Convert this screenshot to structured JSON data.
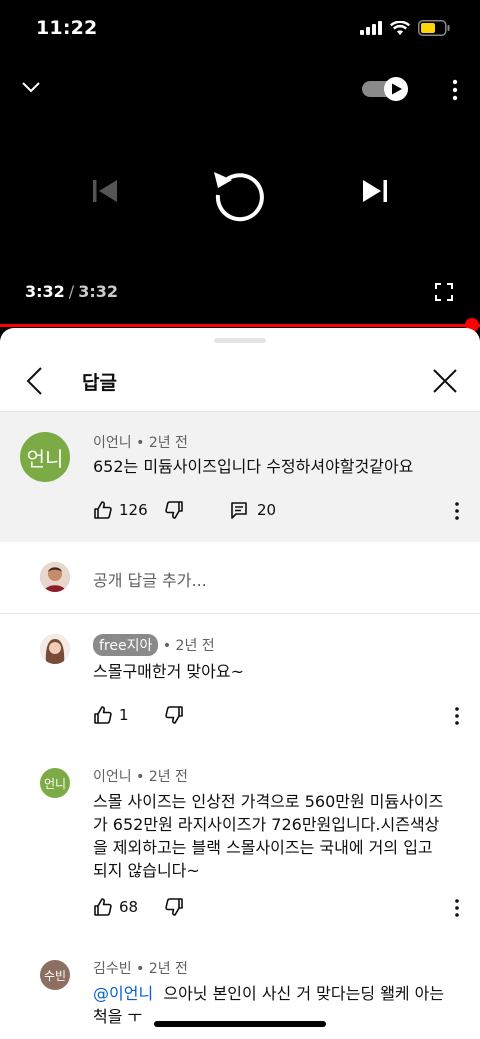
{
  "status": {
    "time": "11:22"
  },
  "player": {
    "current_time": "3:32",
    "separator": "/",
    "total_time": "3:32",
    "progress_fraction": 1.0,
    "accent_color": "#ff0000"
  },
  "sheet": {
    "title": "답글",
    "parent": {
      "avatar_text": "언니",
      "author": "이언니",
      "age": "2년 전",
      "text": "652는 미듐사이즈입니다 수정하셔야할것같아요",
      "likes": "126",
      "replies": "20"
    },
    "composer": {
      "placeholder": "공개 답글 추가..."
    },
    "replies": [
      {
        "author": "free지아",
        "age": "2년 전",
        "text": "스몰구매한거 맞아요~",
        "likes": "1"
      },
      {
        "avatar_text": "언니",
        "author": "이언니",
        "age": "2년 전",
        "text_lines": [
          "스몰 사이즈는 인상전 가격으로 560만원 미듐사이즈",
          "가 652만원 라지사이즈가 726만원입니다.시즌색상",
          "을 제외하고는 블랙 스몰사이즈는 국내에 거의 입고",
          "되지 않습니다~"
        ],
        "likes": "68"
      },
      {
        "avatar_text": "수빈",
        "author": "김수빈",
        "age": "2년 전",
        "mention": "@이언니",
        "text_line1": "으아닛 본인이 사신 거 맞다는딩 왤케 아는",
        "text_line2": "척을 ㅜ"
      }
    ]
  }
}
